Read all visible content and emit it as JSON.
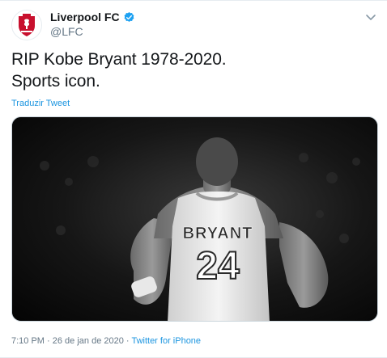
{
  "account": {
    "name": "Liverpool FC",
    "handle": "@LFC",
    "verified": true
  },
  "tweet": {
    "text": "RIP Kobe Bryant 1978-2020.\nSports icon.",
    "translate_label": "Traduzir Tweet",
    "time": "7:10 PM",
    "separator": "·",
    "date": "26 de jan de 2020",
    "source": "Twitter for iPhone"
  },
  "media": {
    "jersey_name": "BRYANT",
    "jersey_number": "24"
  },
  "colors": {
    "link": "#1b95e0",
    "verified": "#1da1f2",
    "muted": "#657786",
    "crest_red": "#c8102e"
  },
  "icons": {
    "avatar": "liverpool-crest-icon",
    "verified": "verified-badge-icon",
    "menu": "chevron-down-icon"
  }
}
